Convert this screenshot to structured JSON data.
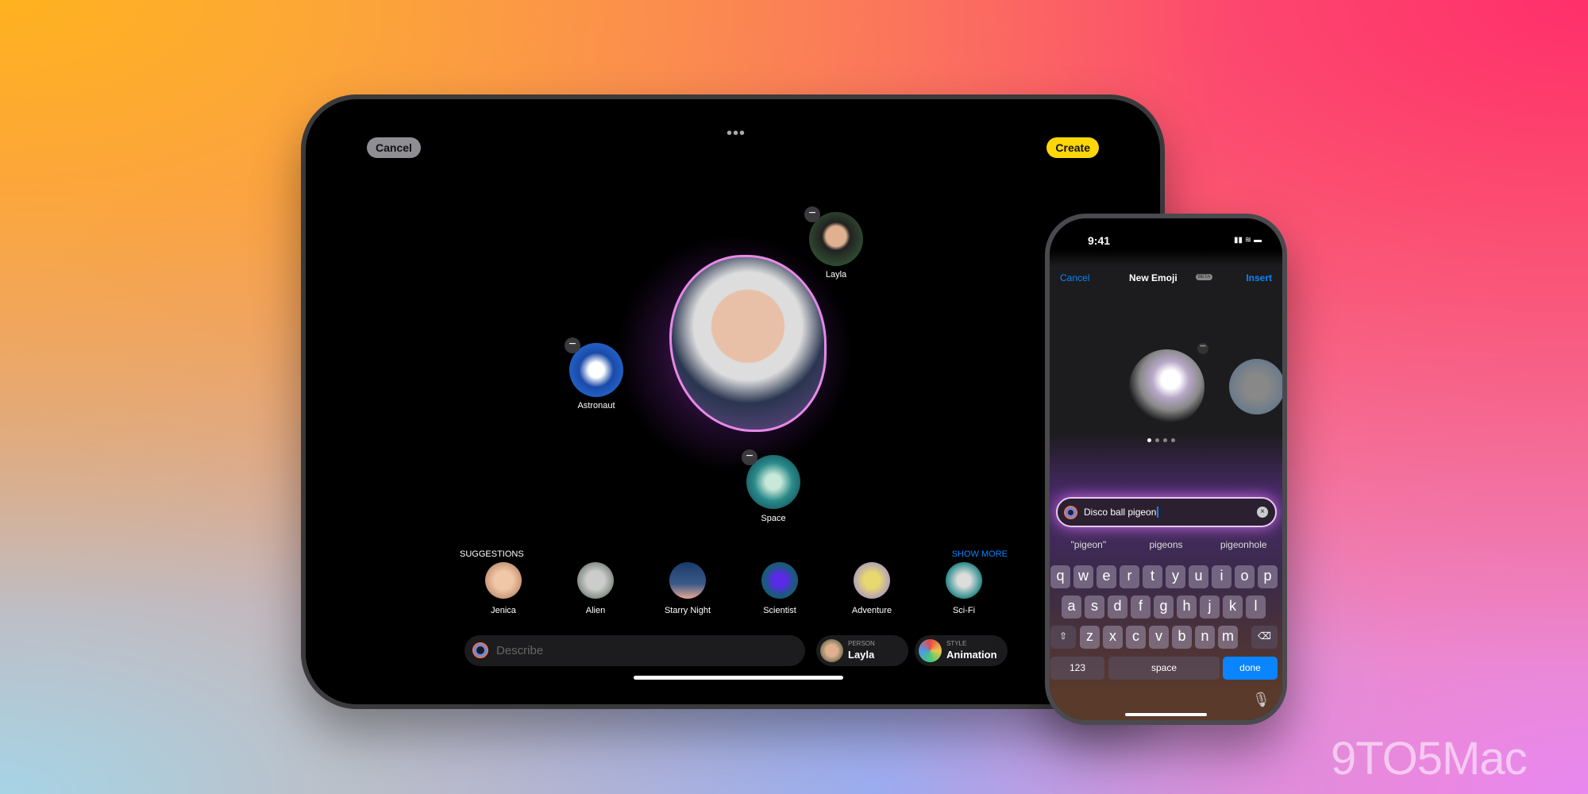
{
  "ipad": {
    "cancel": "Cancel",
    "create": "Create",
    "more_icon": "ellipsis-icon",
    "concepts": [
      {
        "label": "Astronaut"
      },
      {
        "label": "Layla"
      },
      {
        "label": "Space"
      }
    ],
    "suggestions_title": "SUGGESTIONS",
    "show_more": "SHOW MORE",
    "suggestions": [
      {
        "label": "Jenica"
      },
      {
        "label": "Alien"
      },
      {
        "label": "Starry Night"
      },
      {
        "label": "Scientist"
      },
      {
        "label": "Adventure"
      },
      {
        "label": "Sci-Fi"
      }
    ],
    "describe_placeholder": "Describe",
    "person": {
      "caption": "PERSON",
      "value": "Layla"
    },
    "style": {
      "caption": "STYLE",
      "value": "Animation"
    },
    "accent": "#ffd60a"
  },
  "iphone": {
    "time": "9:41",
    "cancel": "Cancel",
    "title": "New Emoji",
    "badge": "BETA",
    "insert": "Insert",
    "page_count": 4,
    "page_index": 1,
    "input_value": "Disco ball pigeon",
    "predictions": [
      "\"pigeon\"",
      "pigeons",
      "pigeonhole"
    ],
    "keys_row1": [
      "q",
      "w",
      "e",
      "r",
      "t",
      "y",
      "u",
      "i",
      "o",
      "p"
    ],
    "keys_row2": [
      "a",
      "s",
      "d",
      "f",
      "g",
      "h",
      "j",
      "k",
      "l"
    ],
    "keys_row3": [
      "z",
      "x",
      "c",
      "v",
      "b",
      "n",
      "m"
    ],
    "key_123": "123",
    "key_space": "space",
    "key_done": "done",
    "accent": "#0a84ff"
  },
  "watermark": "9TO5Mac"
}
